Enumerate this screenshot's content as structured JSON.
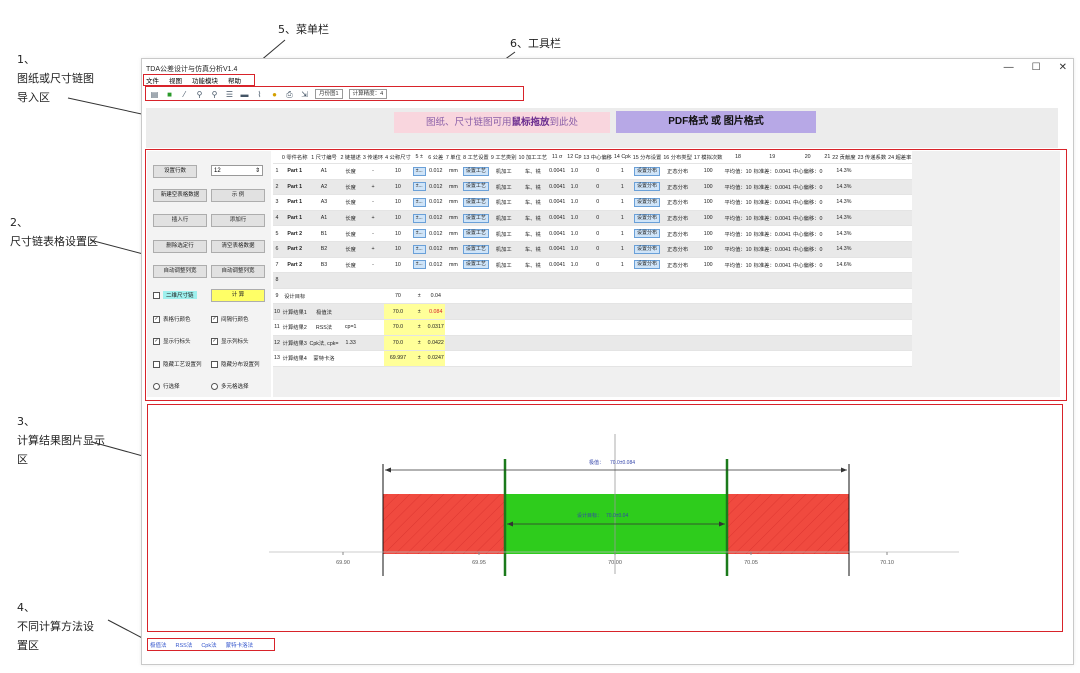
{
  "annotations": {
    "a1": [
      "1、",
      "图纸或尺寸链图",
      "导入区"
    ],
    "a2": [
      "2、",
      "尺寸链表格设置区"
    ],
    "a3": [
      "3、",
      "计算结果图片显示",
      "区"
    ],
    "a4": [
      "4、",
      "不同计算方法设",
      "置区"
    ],
    "a5": "5、菜单栏",
    "a6": "6、工具栏"
  },
  "window": {
    "title": "TDA公差设计与仿真分析V1.4",
    "controls": [
      "—",
      "☐",
      "✕"
    ]
  },
  "menu": [
    "文件",
    "视图",
    "功能模块",
    "帮助"
  ],
  "toolbar": {
    "icons": [
      "open-icon",
      "camera-icon",
      "wand-icon",
      "magnify-icon",
      "zoom-in-icon",
      "list-icon",
      "line-icon",
      "curve-icon",
      "bulb-icon",
      "print-icon",
      "export-icon"
    ],
    "select1": "月份图1",
    "select2": "计算精度：4"
  },
  "import": {
    "hint": "图纸、尺寸链图可用",
    "hint_bold": "鼠标拖放",
    "hint_tail": "到此处",
    "format": "PDF格式 或 图片格式"
  },
  "left_panel": {
    "count_label": "设置行数",
    "count_value": "12",
    "btn_new": "新建空表格数据",
    "btn_example": "示 例",
    "btn_insert": "插入行",
    "btn_add": "添加行",
    "btn_delete": "删除选定行",
    "btn_clear": "清空表格数据",
    "btn_autowidth": "自动调整列宽",
    "btn_autoheight": "自动调整列宽",
    "chk_2d": "二维尺寸链",
    "btn_calc": "计 算",
    "chk_rowcolor": "表格行颜色",
    "chk_interval": "间隔行颜色",
    "chk_showrow": "显示行标头",
    "chk_showcol": "显示列标头",
    "chk_hideproc": "隐藏工艺设置列",
    "chk_hidedist": "隐藏分布设置列",
    "radio_row": "行选择",
    "radio_multi": "多元格选择"
  },
  "grid": {
    "headers": [
      "",
      "0 零件名称",
      "1 尺寸编号",
      "2 链描述",
      "3 传递环",
      "4 公称尺寸",
      "5 ±",
      "6 公差",
      "7 单位",
      "8 工艺设置",
      "9 工艺类别",
      "10 加工工艺",
      "11 σ",
      "12 Cp",
      "13 中心偏移",
      "14 Cpk",
      "15 分布设置",
      "16 分布类型",
      "17 模拟次数",
      "18",
      "19",
      "20",
      "21",
      "22 贡献度",
      "23 传递系数",
      "24 超差率"
    ],
    "rows": [
      [
        "1",
        "Part 1",
        "A1",
        "长度",
        "-",
        "10",
        "±...",
        "0.012",
        "mm",
        "设置工艺",
        "机加工",
        "车、铣",
        "0.0041",
        "1.0",
        "0",
        "1",
        "设置分布",
        "正态分布",
        "100",
        "平均值：10",
        "标准差：0.0041",
        "中心偏移：0",
        "",
        "14.3%",
        "",
        ""
      ],
      [
        "2",
        "Part 1",
        "A2",
        "长度",
        "+",
        "10",
        "±...",
        "0.012",
        "mm",
        "设置工艺",
        "机加工",
        "车、铣",
        "0.0041",
        "1.0",
        "0",
        "1",
        "设置分布",
        "正态分布",
        "100",
        "平均值：10",
        "标准差：0.0041",
        "中心偏移：0",
        "",
        "14.3%",
        "",
        ""
      ],
      [
        "3",
        "Part 1",
        "A3",
        "长度",
        "-",
        "10",
        "±...",
        "0.012",
        "mm",
        "设置工艺",
        "机加工",
        "车、铣",
        "0.0041",
        "1.0",
        "0",
        "1",
        "设置分布",
        "正态分布",
        "100",
        "平均值：10",
        "标准差：0.0041",
        "中心偏移：0",
        "",
        "14.3%",
        "",
        ""
      ],
      [
        "4",
        "Part 1",
        "A1",
        "长度",
        "+",
        "10",
        "±...",
        "0.012",
        "mm",
        "设置工艺",
        "机加工",
        "车、铣",
        "0.0041",
        "1.0",
        "0",
        "1",
        "设置分布",
        "正态分布",
        "100",
        "平均值：10",
        "标准差：0.0041",
        "中心偏移：0",
        "",
        "14.3%",
        "",
        ""
      ],
      [
        "5",
        "Part 2",
        "B1",
        "长度",
        "-",
        "10",
        "±...",
        "0.012",
        "mm",
        "设置工艺",
        "机加工",
        "车、铣",
        "0.0041",
        "1.0",
        "0",
        "1",
        "设置分布",
        "正态分布",
        "100",
        "平均值：10",
        "标准差：0.0041",
        "中心偏移：0",
        "",
        "14.3%",
        "",
        ""
      ],
      [
        "6",
        "Part 2",
        "B2",
        "长度",
        "+",
        "10",
        "±...",
        "0.012",
        "mm",
        "设置工艺",
        "机加工",
        "车、铣",
        "0.0041",
        "1.0",
        "0",
        "1",
        "设置分布",
        "正态分布",
        "100",
        "平均值：10",
        "标准差：0.0041",
        "中心偏移：0",
        "",
        "14.3%",
        "",
        ""
      ],
      [
        "7",
        "Part 2",
        "B3",
        "长度",
        "-",
        "10",
        "±...",
        "0.012",
        "mm",
        "设置工艺",
        "机加工",
        "车、铣",
        "0.0041",
        "1.0",
        "0",
        "1",
        "设置分布",
        "正态分布",
        "100",
        "平均值：10",
        "标准差：0.0041",
        "中心偏移：0",
        "",
        "14.6%",
        "",
        ""
      ]
    ],
    "results": [
      {
        "n": "9",
        "name": "设计目标",
        "method": "",
        "cp": "",
        "cpv": "",
        "nom": "70",
        "pm": "±",
        "tol": "0.04",
        "extra": ""
      },
      {
        "n": "10",
        "name": "计算结果1",
        "method": "极值法",
        "cp": "",
        "cpv": "",
        "nom": "70.0",
        "pm": "±",
        "tol": "0.084",
        "extra": ""
      },
      {
        "n": "11",
        "name": "计算结果2",
        "method": "RSS法",
        "cp": "cp=1",
        "cpv": "",
        "nom": "70.0",
        "pm": "±",
        "tol": "0.0317",
        "extra": ""
      },
      {
        "n": "12",
        "name": "计算结果3",
        "method": "Cpk法, cpk=",
        "cp": "1.33",
        "cpv": "",
        "nom": "70.0",
        "pm": "±",
        "tol": "0.0422",
        "extra": ""
      },
      {
        "n": "13",
        "name": "计算结果4",
        "method": "蒙特卡洛",
        "cp": "",
        "cpv": "",
        "nom": "69.997",
        "pm": "±",
        "tol": "0.0247",
        "extra": ""
      }
    ]
  },
  "chart": {
    "top_label": "极值：",
    "top_value": "70.0±0.084",
    "inner_label": "设计目标：",
    "inner_value": "70.0±0.04",
    "ticks": [
      "69.90",
      "69.95",
      "70.00",
      "70.05",
      "70.10"
    ],
    "colors": {
      "red": "#f04a3f",
      "green": "#2ecc1c",
      "line": "#1b7a1b"
    }
  },
  "tabs": [
    "极值法",
    "RSS法",
    "Cpk法",
    "蒙特卡洛法"
  ]
}
